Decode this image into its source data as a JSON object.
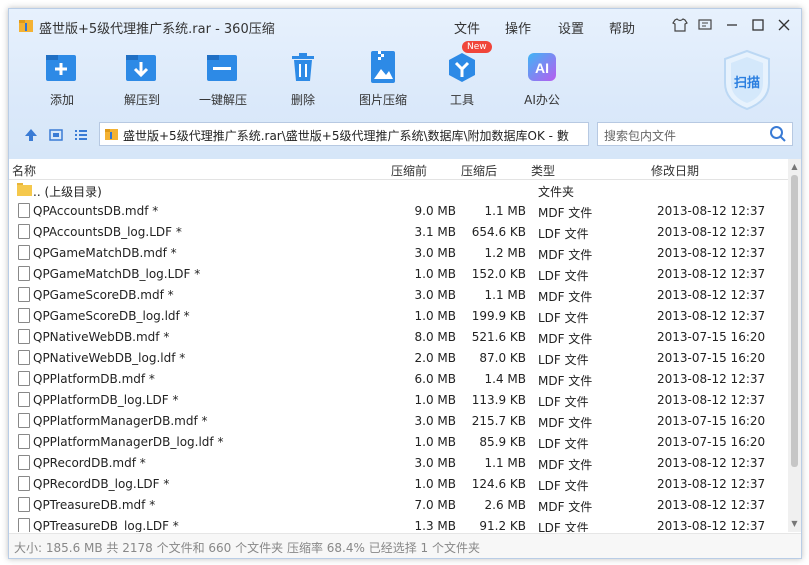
{
  "window": {
    "title": "盛世版+5级代理推广系统.rar - 360压缩",
    "menu": [
      "文件",
      "操作",
      "设置",
      "帮助"
    ]
  },
  "toolbar": {
    "items": [
      {
        "label": "添加",
        "icon": "add-icon"
      },
      {
        "label": "解压到",
        "icon": "extract-to-icon"
      },
      {
        "label": "一键解压",
        "icon": "one-click-extract-icon"
      },
      {
        "label": "删除",
        "icon": "delete-icon"
      },
      {
        "label": "图片压缩",
        "icon": "image-compress-icon"
      },
      {
        "label": "工具",
        "icon": "tools-icon",
        "badge": "New"
      },
      {
        "label": "AI办公",
        "icon": "ai-office-icon",
        "icon_text": "AI"
      }
    ],
    "scan_label": "扫描"
  },
  "nav": {
    "path": "盛世版+5级代理推广系统.rar\\盛世版+5级代理推广系统\\数据库\\附加数据库OK - 數",
    "search_placeholder": "搜索包内文件"
  },
  "columns": {
    "name": "名称",
    "compressed_before": "压缩前",
    "compressed_after": "压缩后",
    "type": "类型",
    "modified": "修改日期"
  },
  "rows": [
    {
      "name": ".. (上级目录)",
      "size": "",
      "packed": "",
      "type": "文件夹",
      "date": "",
      "folder": true
    },
    {
      "name": "QPAccountsDB.mdf *",
      "size": "9.0 MB",
      "packed": "1.1 MB",
      "type": "MDF 文件",
      "date": "2013-08-12 12:37"
    },
    {
      "name": "QPAccountsDB_log.LDF *",
      "size": "3.1 MB",
      "packed": "654.6 KB",
      "type": "LDF 文件",
      "date": "2013-08-12 12:37"
    },
    {
      "name": "QPGameMatchDB.mdf *",
      "size": "3.0 MB",
      "packed": "1.2 MB",
      "type": "MDF 文件",
      "date": "2013-08-12 12:37"
    },
    {
      "name": "QPGameMatchDB_log.LDF *",
      "size": "1.0 MB",
      "packed": "152.0 KB",
      "type": "LDF 文件",
      "date": "2013-08-12 12:37"
    },
    {
      "name": "QPGameScoreDB.mdf *",
      "size": "3.0 MB",
      "packed": "1.1 MB",
      "type": "MDF 文件",
      "date": "2013-08-12 12:37"
    },
    {
      "name": "QPGameScoreDB_log.ldf *",
      "size": "1.0 MB",
      "packed": "199.9 KB",
      "type": "LDF 文件",
      "date": "2013-08-12 12:37"
    },
    {
      "name": "QPNativeWebDB.mdf *",
      "size": "8.0 MB",
      "packed": "521.6 KB",
      "type": "MDF 文件",
      "date": "2013-07-15 16:20"
    },
    {
      "name": "QPNativeWebDB_log.ldf *",
      "size": "2.0 MB",
      "packed": "87.0 KB",
      "type": "LDF 文件",
      "date": "2013-07-15 16:20"
    },
    {
      "name": "QPPlatformDB.mdf *",
      "size": "6.0 MB",
      "packed": "1.4 MB",
      "type": "MDF 文件",
      "date": "2013-08-12 12:37"
    },
    {
      "name": "QPPlatformDB_log.LDF *",
      "size": "1.0 MB",
      "packed": "113.9 KB",
      "type": "LDF 文件",
      "date": "2013-08-12 12:37"
    },
    {
      "name": "QPPlatformManagerDB.mdf *",
      "size": "3.0 MB",
      "packed": "215.7 KB",
      "type": "MDF 文件",
      "date": "2013-07-15 16:20"
    },
    {
      "name": "QPPlatformManagerDB_log.ldf *",
      "size": "1.0 MB",
      "packed": "85.9 KB",
      "type": "LDF 文件",
      "date": "2013-07-15 16:20"
    },
    {
      "name": "QPRecordDB.mdf *",
      "size": "3.0 MB",
      "packed": "1.1 MB",
      "type": "MDF 文件",
      "date": "2013-08-12 12:37"
    },
    {
      "name": "QPRecordDB_log.LDF *",
      "size": "1.0 MB",
      "packed": "124.6 KB",
      "type": "LDF 文件",
      "date": "2013-08-12 12:37"
    },
    {
      "name": "QPTreasureDB.mdf *",
      "size": "7.0 MB",
      "packed": "2.6 MB",
      "type": "MDF 文件",
      "date": "2013-08-12 12:37"
    },
    {
      "name": "QPTreasureDB_log.LDF *",
      "size": "1.3 MB",
      "packed": "91.2 KB",
      "type": "LDF 文件",
      "date": "2013-08-12 12:37"
    }
  ],
  "status": "大小: 185.6 MB 共 2178 个文件和 660 个文件夹 压缩率 68.4% 已经选择 1 个文件夹",
  "colors": {
    "accent": "#2b7fe0",
    "toolbar_bg": "#dbe9fa"
  }
}
